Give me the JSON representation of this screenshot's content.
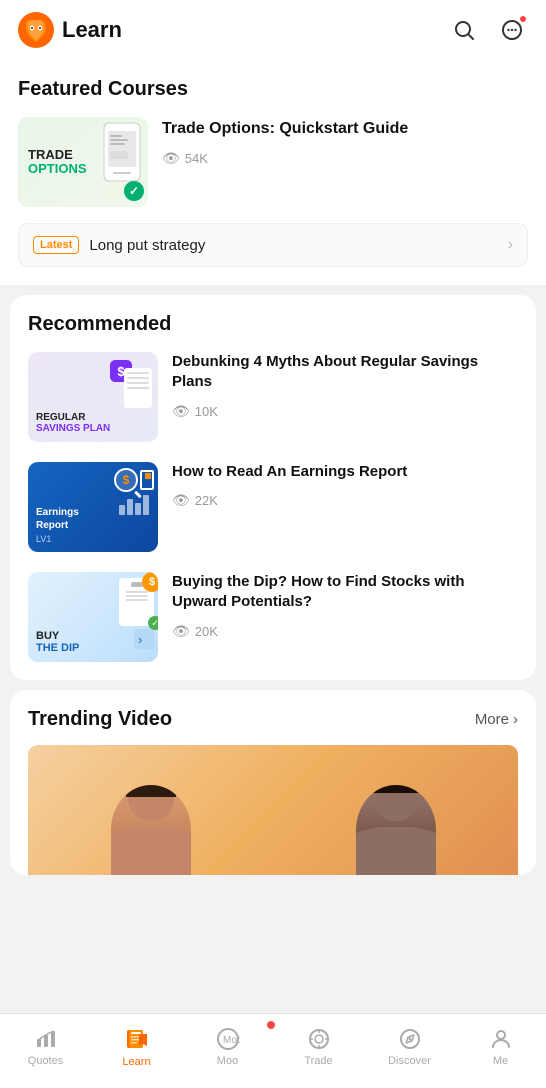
{
  "header": {
    "title": "Learn",
    "search_label": "search",
    "messages_label": "messages"
  },
  "featured": {
    "section_title": "Featured Courses",
    "course": {
      "thumb_line1": "TRADE",
      "thumb_line2": "OPTIONS",
      "title": "Trade Options: Quickstart Guide",
      "views": "54K"
    },
    "latest_badge": "Latest",
    "latest_text": "Long put strategy"
  },
  "recommended": {
    "section_title": "Recommended",
    "items": [
      {
        "thumb_line1": "REGULAR",
        "thumb_line2": "SAVINGS PLAN",
        "title": "Debunking 4 Myths About Regular Savings Plans",
        "views": "10K"
      },
      {
        "thumb_line1": "Earnings",
        "thumb_line2": "Report",
        "thumb_lv": "LV1",
        "title": "How to Read An Earnings Report",
        "views": "22K"
      },
      {
        "thumb_line1": "BUY",
        "thumb_line2": "THE DIP",
        "title": "Buying the Dip? How to Find Stocks with Upward Potentials?",
        "views": "20K"
      }
    ]
  },
  "trending": {
    "section_title": "Trending Video",
    "more_label": "More"
  },
  "bottom_nav": {
    "items": [
      {
        "label": "Quotes",
        "icon": "📈",
        "active": false
      },
      {
        "label": "Learn",
        "icon": "📖",
        "active": true
      },
      {
        "label": "Moo",
        "icon": "🐄",
        "active": false,
        "has_dot": true
      },
      {
        "label": "Trade",
        "icon": "◎",
        "active": false
      },
      {
        "label": "Discover",
        "icon": "🧭",
        "active": false
      },
      {
        "label": "Me",
        "icon": "👤",
        "active": false
      }
    ]
  }
}
